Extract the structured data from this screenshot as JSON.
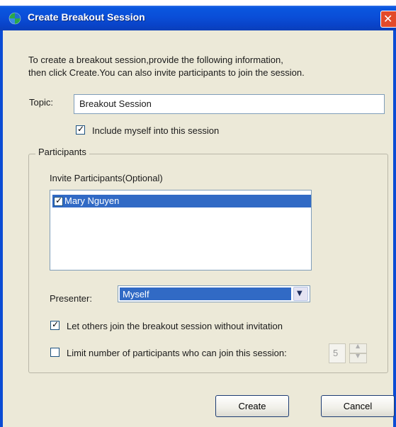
{
  "window": {
    "title": "Create Breakout Session",
    "close_glyph": "✕"
  },
  "intro": {
    "line1": "To create a breakout session,provide the following information,",
    "line2": "then click Create.You can also invite participants to join the session."
  },
  "topic": {
    "label": "Topic:",
    "value": "Breakout Session"
  },
  "include_myself": {
    "label": "Include myself into this session",
    "checked": true
  },
  "participants": {
    "group_label": "Participants",
    "invite_label": "Invite Participants(Optional)",
    "items": [
      {
        "name": "Mary Nguyen",
        "checked": true,
        "selected": true
      }
    ]
  },
  "presenter": {
    "label": "Presenter:",
    "selected": "Myself"
  },
  "let_others_join": {
    "label": "Let others join the breakout session without invitation",
    "checked": true
  },
  "limit": {
    "label": "Limit number of participants who can join this session:",
    "checked": false,
    "value": "5"
  },
  "buttons": {
    "create": "Create",
    "cancel": "Cancel"
  },
  "colors": {
    "titlebar": "#0a4ed8",
    "selection": "#316ac5",
    "client_bg": "#ece9d8"
  }
}
